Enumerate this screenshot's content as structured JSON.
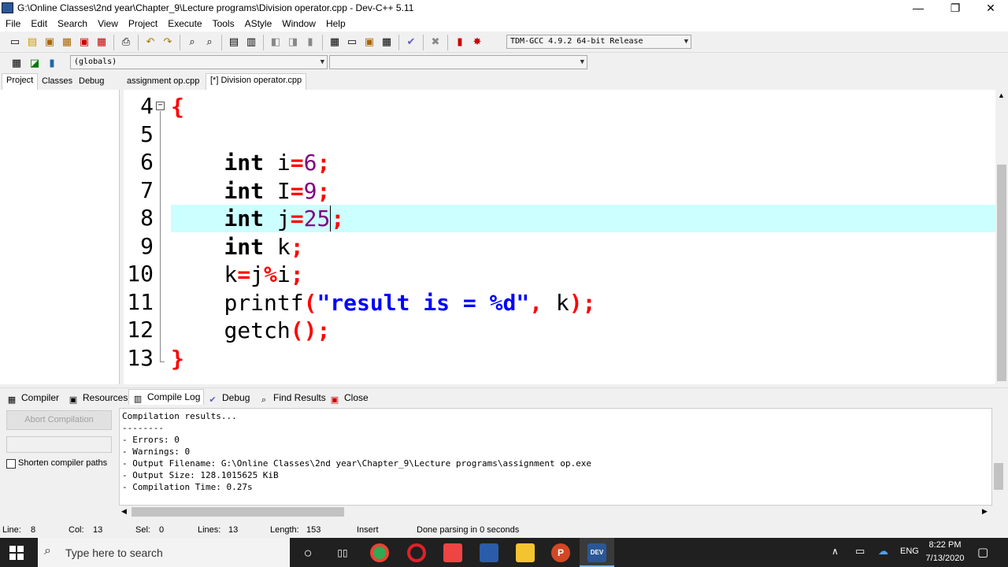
{
  "window": {
    "title": "G:\\Online Classes\\2nd year\\Chapter_9\\Lecture programs\\Division operator.cpp - Dev-C++ 5.11",
    "minimize": "—",
    "maximize": "❐",
    "close": "✕"
  },
  "menu": [
    "File",
    "Edit",
    "Search",
    "View",
    "Project",
    "Execute",
    "Tools",
    "AStyle",
    "Window",
    "Help"
  ],
  "toolbar": {
    "compiler_select": "TDM-GCC 4.9.2 64-bit Release",
    "globals_select": "(globals)",
    "symbols_select": ""
  },
  "left_tabs": [
    "Project",
    "Classes",
    "Debug"
  ],
  "file_tabs": [
    "assignment op.cpp",
    "[*] Division operator.cpp"
  ],
  "editor": {
    "line_numbers": [
      "4",
      "5",
      "6",
      "7",
      "8",
      "9",
      "10",
      "11",
      "12",
      "13"
    ],
    "code": {
      "l4_brace": "{",
      "l6_kw": "int",
      "l6_var": " i",
      "l6_eq": "=",
      "l6_num": "6",
      "l6_semi": ";",
      "l7_kw": "int",
      "l7_var": " I",
      "l7_eq": "=",
      "l7_num": "9",
      "l7_semi": ";",
      "l8_kw": "int",
      "l8_var": " j",
      "l8_eq": "=",
      "l8_num": "25",
      "l8_semi": ";",
      "l9_kw": "int",
      "l9_var": " k",
      "l9_semi": ";",
      "l10_a": "k",
      "l10_eq": "=",
      "l10_b": "j",
      "l10_mod": "%",
      "l10_c": "i",
      "l10_semi": ";",
      "l11_fn": "printf",
      "l11_open": "(",
      "l11_str": "\"result is = %d\"",
      "l11_comma": ",",
      "l11_arg": " k",
      "l11_close": ");",
      "l12_fn": "getch",
      "l12_paren": "();",
      "l13_brace": "}"
    }
  },
  "bottom_tabs": [
    "Compiler",
    "Resources",
    "Compile Log",
    "Debug",
    "Find Results",
    "Close"
  ],
  "log_panel": {
    "abort_button": "Abort Compilation",
    "shorten_label": "Shorten compiler paths",
    "lines": [
      "Compilation results...",
      "--------",
      "- Errors: 0",
      "- Warnings: 0",
      "- Output Filename: G:\\Online Classes\\2nd year\\Chapter_9\\Lecture programs\\assignment op.exe",
      "- Output Size: 128.1015625 KiB",
      "- Compilation Time: 0.27s"
    ]
  },
  "status": {
    "line_label": "Line:",
    "line_value": "8",
    "col_label": "Col:",
    "col_value": "13",
    "sel_label": "Sel:",
    "sel_value": "0",
    "lines_label": "Lines:",
    "lines_value": "13",
    "length_label": "Length:",
    "length_value": "153",
    "mode": "Insert",
    "message": "Done parsing in 0 seconds"
  },
  "taskbar": {
    "search_placeholder": "Type here to search",
    "language": "ENG",
    "time": "8:22 PM",
    "date": "7/13/2020"
  }
}
